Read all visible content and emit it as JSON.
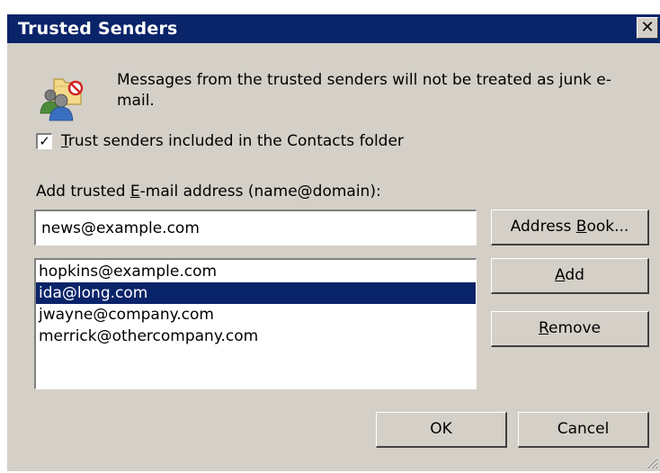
{
  "window": {
    "title": "Trusted Senders",
    "close_glyph": "✕"
  },
  "info": {
    "icon": "trusted-senders-icon",
    "text": "Messages from the trusted senders will not be treated as junk e-mail."
  },
  "contacts_checkbox": {
    "checked": true,
    "check_glyph": "✓",
    "label_mnemonic": "T",
    "label_rest": "rust senders included in the Contacts folder"
  },
  "address_field": {
    "label_prefix": "Add trusted ",
    "label_mnemonic": "E",
    "label_suffix": "-mail address (name@domain):",
    "value": "news@example.com"
  },
  "buttons": {
    "address_book_prefix": "Address ",
    "address_book_mnemonic": "B",
    "address_book_suffix": "ook...",
    "add_mnemonic": "A",
    "add_suffix": "dd",
    "remove_mnemonic": "R",
    "remove_suffix": "emove",
    "ok": "OK",
    "cancel": "Cancel"
  },
  "senders": [
    {
      "address": "hopkins@example.com",
      "selected": false
    },
    {
      "address": "ida@long.com",
      "selected": true
    },
    {
      "address": "jwayne@company.com",
      "selected": false
    },
    {
      "address": "merrick@othercompany.com",
      "selected": false
    }
  ],
  "colors": {
    "face": "#d4d0c8",
    "title_bar": "#0a246a",
    "selection": "#0a246a"
  }
}
